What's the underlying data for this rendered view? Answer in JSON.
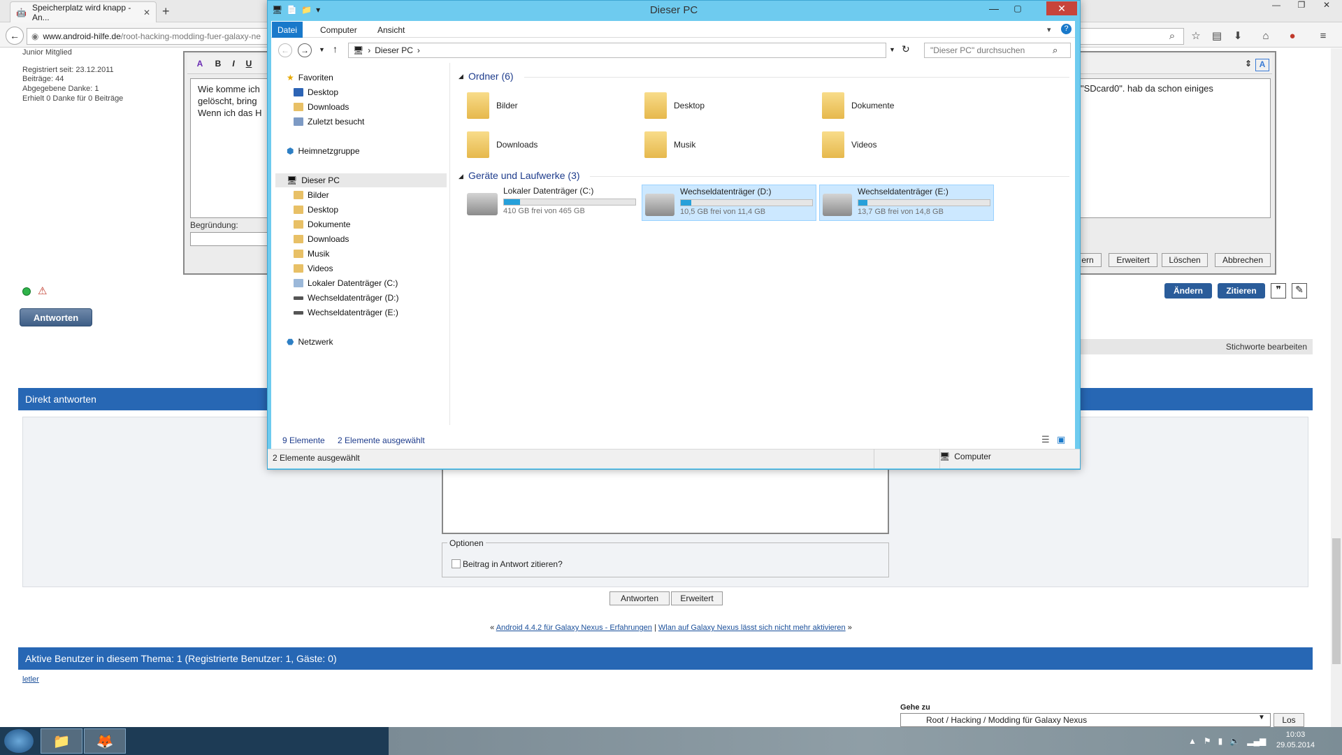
{
  "browser": {
    "tab_title": "Speicherplatz wird knapp - An...",
    "url_domain": "www.android-hilfe.de",
    "url_path": "/root-hacking-modding-fuer-galaxy-ne"
  },
  "forum": {
    "user_rank": "Junior Mitglied",
    "user_info": [
      "Registriert seit: 23.12.2011",
      "Beiträge: 44",
      "Abgegebene Danke: 1",
      "Erhielt 0 Danke für 0 Beiträge"
    ],
    "editor_text_lines": [
      "Wie komme ich",
      "gelöscht, bring",
      "Wenn ich das H"
    ],
    "editor_text_right": "\"SDcard0\". hab da schon einiges",
    "format_buttons": [
      "B",
      "I",
      "U"
    ],
    "reason_label": "Begründung:",
    "edit_buttons": [
      "ern",
      "Erweitert",
      "Löschen",
      "Abbrechen"
    ],
    "post_actions": [
      "Ändern",
      "Zitieren"
    ],
    "reply_button": "Antworten",
    "tags_edit": "Stichworte bearbeiten",
    "quick_reply_header": "Direkt antworten",
    "options_legend": "Optionen",
    "quote_checkbox_label": "Beitrag in Antwort zitieren?",
    "reply_submit": "Antworten",
    "reply_advanced": "Erweitert",
    "thread_prev": "Android 4.4.2 für Galaxy Nexus - Erfahrungen",
    "thread_next": "Wlan auf Galaxy Nexus lässt sich nicht mehr aktivieren",
    "active_users_header": "Aktive Benutzer in diesem Thema: 1 (Registrierte Benutzer: 1, Gäste: 0)",
    "active_user": "letler",
    "goto_label": "Gehe zu",
    "goto_selected": "Root / Hacking / Modding für Galaxy Nexus",
    "goto_button": "Los"
  },
  "explorer": {
    "title": "Dieser PC",
    "ribbon_tabs": [
      "Datei",
      "Computer",
      "Ansicht"
    ],
    "address": "Dieser PC",
    "search_placeholder": "\"Dieser PC\" durchsuchen",
    "nav": {
      "favorites": "Favoriten",
      "fav_items": [
        "Desktop",
        "Downloads",
        "Zuletzt besucht"
      ],
      "homegroup": "Heimnetzgruppe",
      "this_pc": "Dieser PC",
      "pc_items": [
        "Bilder",
        "Desktop",
        "Dokumente",
        "Downloads",
        "Musik",
        "Videos",
        "Lokaler Datenträger (C:)",
        "Wechseldatenträger (D:)",
        "Wechseldatenträger (E:)"
      ],
      "network": "Netzwerk"
    },
    "folders_header": "Ordner (6)",
    "folders": [
      "Bilder",
      "Desktop",
      "Dokumente",
      "Downloads",
      "Musik",
      "Videos"
    ],
    "drives_header": "Geräte und Laufwerke (3)",
    "drives": [
      {
        "name": "Lokaler Datenträger (C:)",
        "free": "410 GB frei von 465 GB",
        "used_fraction": 0.12,
        "selected": false
      },
      {
        "name": "Wechseldatenträger (D:)",
        "free": "10,5 GB frei von 11,4 GB",
        "used_fraction": 0.08,
        "selected": true
      },
      {
        "name": "Wechseldatenträger (E:)",
        "free": "13,7 GB frei von 14,8 GB",
        "used_fraction": 0.07,
        "selected": true
      }
    ],
    "status_count": "9 Elemente",
    "status_selected": "2 Elemente ausgewählt",
    "bottom_selected": "2 Elemente ausgewählt",
    "bottom_location": "Computer"
  },
  "taskbar": {
    "time": "10:03",
    "date": "29.05.2014"
  },
  "colors": {
    "accent_blue": "#2767b4",
    "explorer_frame": "#6ecbef",
    "drive_bar": "#26a0da",
    "selection": "#cce8ff"
  }
}
